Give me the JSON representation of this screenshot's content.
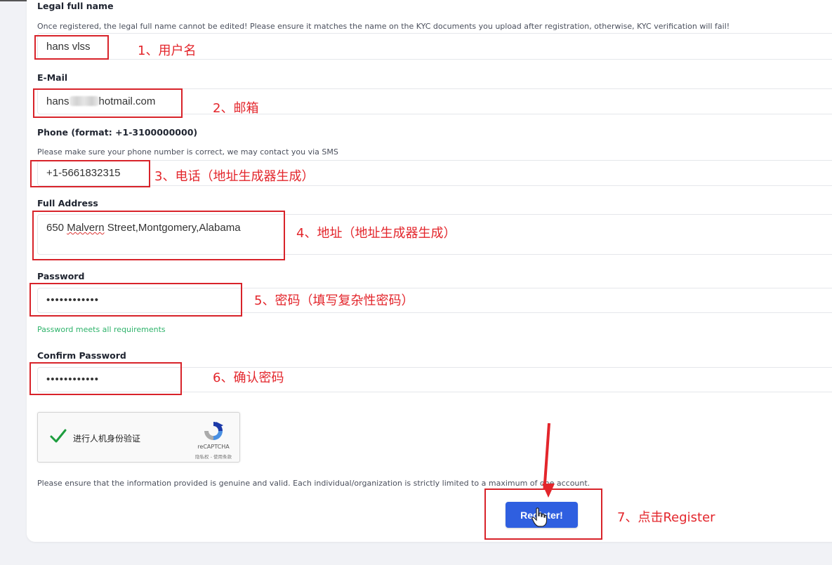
{
  "fields": {
    "legal_name": {
      "label": "Legal full name",
      "help": "Once registered, the legal full name cannot be edited! Please ensure it matches the name on the KYC documents you upload after registration, otherwise, KYC verification will fail!",
      "value": "hans vlss"
    },
    "email": {
      "label": "E-Mail",
      "value_prefix": "hans",
      "value_suffix": "hotmail.com"
    },
    "phone": {
      "label": "Phone (format: +1-3100000000)",
      "help": "Please make sure your phone number is correct, we may contact you via SMS",
      "value": "+1-5661832315"
    },
    "address": {
      "label": "Full Address",
      "value_pre": "650 ",
      "value_word": "Malvern",
      "value_post": " Street,Montgomery,Alabama"
    },
    "password": {
      "label": "Password",
      "value": "••••••••••••",
      "status": "Password meets all requirements"
    },
    "confirm_password": {
      "label": "Confirm Password",
      "value": "••••••••••••"
    }
  },
  "captcha": {
    "text": "进行人机身份验证",
    "brand": "reCAPTCHA",
    "links": "隐私权 - 使用条款"
  },
  "notice": "Please ensure that the information provided is genuine and valid. Each individual/organization is strictly limited to a maximum of one account.",
  "register_button": "Register!",
  "annotations": {
    "a1": "1、用户名",
    "a2": "2、邮箱",
    "a3": "3、电话（地址生成器生成）",
    "a4": "4、地址（地址生成器生成）",
    "a5": "5、密码（填写复杂性密码）",
    "a6": "6、确认密码",
    "a7": "7、点击Register"
  },
  "colors": {
    "annotation_red": "#e3252b",
    "button_blue": "#2f5fe0",
    "success_green": "#2fb36b"
  }
}
